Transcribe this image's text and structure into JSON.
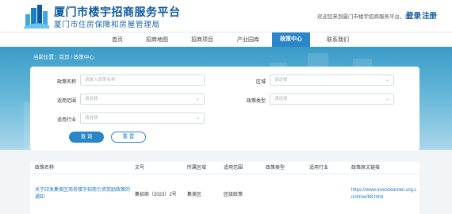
{
  "header": {
    "title": "厦门市楼宇招商服务平台",
    "subtitle": "厦门市住房保障和房屋管理局",
    "welcome": "欢迎您来到厦门市楼宇招商服务平台，请",
    "login": "登录",
    "register": "注册"
  },
  "nav": {
    "items": [
      "首页",
      "招商地图",
      "招商项目",
      "产业园库",
      "政策中心",
      "联系我们"
    ],
    "active": "政策中心"
  },
  "breadcrumb": "当前位置：首页 / 政策中心",
  "search": {
    "policy_name_label": "政策名称",
    "policy_name_placeholder": "请输入政策名称",
    "region_label": "区域",
    "region_placeholder": "请选择",
    "scope_label": "适用范围",
    "scope_placeholder": "请选择",
    "type_label": "政策类型",
    "type_placeholder": "请选择",
    "industry_label": "适用行业",
    "industry_placeholder": "请选择",
    "query_button": "查 询",
    "reset_button": "重 置"
  },
  "table": {
    "headers": [
      "政策名称",
      "文号",
      "所属区域",
      "适用范围",
      "政策类型",
      "适用行业",
      "政策原文链接"
    ],
    "rows": [
      {
        "name": "关于印发集美区商务楼宇招商引资奖励政策的通知",
        "doc_no": "集招商〔2023〕2号",
        "region": "集美区",
        "scope": "区级政策",
        "type": "",
        "industry": "",
        "link": "https://www.investxiamen.org.cn/show/68.html"
      }
    ]
  },
  "colors": {
    "primary": "#2a86c9",
    "brand": "#0c5a9e",
    "banner": "#63b6d8"
  }
}
